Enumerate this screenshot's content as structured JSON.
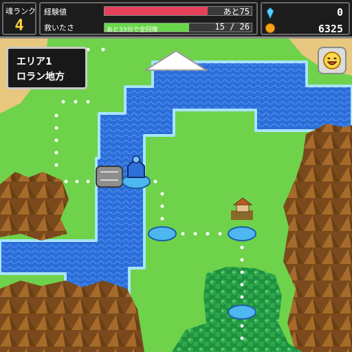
{
  "hud": {
    "rank_label": "魂ランク",
    "rank_value": "4",
    "exp_label": "経験値",
    "exp_text": "あと75",
    "exp_fraction": 0.7,
    "rescue_label": "救いたさ",
    "rescue_note": "あと33分で全回復",
    "rescue_text": "15 / 26",
    "rescue_fraction": 0.577,
    "gems_value": "0",
    "coins_value": "6325"
  },
  "area": {
    "line1": "エリア1",
    "line2": "ロラン地方"
  },
  "colors": {
    "grass": "#6fd24b",
    "water": "#2c6ed8",
    "water_light": "#4a8cf0",
    "shore": "#a8e4ff",
    "sand": "#e8c77e",
    "mountain": "#a66a2a",
    "forest": "#1f8f3f",
    "node": "#4fb7f0",
    "exp_bar": "#e7405a",
    "rescue_bar": "#6ad64a",
    "gold": "#ffd23a"
  },
  "icons": [
    "gem-icon",
    "coin-icon",
    "face-icon",
    "up-arrow-icon",
    "hero-icon",
    "house-icon",
    "bridge-icon"
  ]
}
